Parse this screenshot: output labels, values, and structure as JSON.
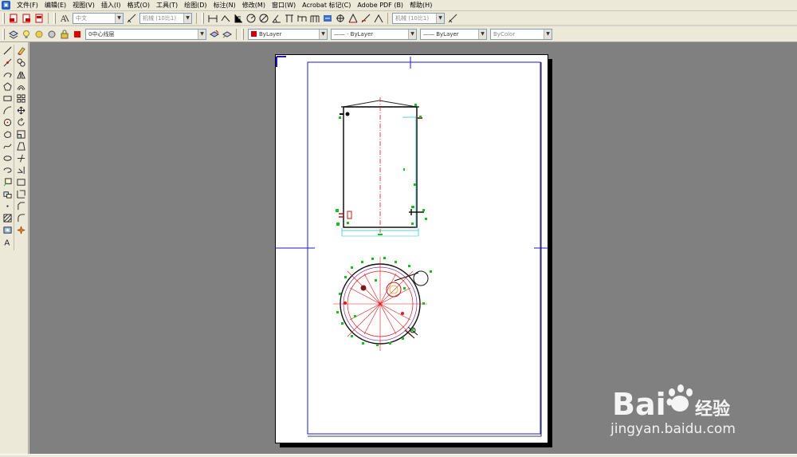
{
  "menu": {
    "items": [
      "文件(F)",
      "编辑(E)",
      "视图(V)",
      "插入(I)",
      "格式(O)",
      "工具(T)",
      "绘图(D)",
      "标注(N)",
      "修改(M)",
      "窗口(W)",
      "Acrobat 标记(C)",
      "Adobe PDF (B)",
      "帮助(H)"
    ]
  },
  "toolbar1": {
    "text_style": "中文",
    "dim_style_1": "机械 (10比1)",
    "dim_style_2": "机械 (10比1)"
  },
  "toolbar2": {
    "layer": "0中心线层",
    "color": "ByLayer",
    "linetype": "—— · ByLayer",
    "lineweight": "—— ByLayer",
    "plotstyle": "ByColor",
    "color_swatch": "#cc0000"
  },
  "draw_tools": [
    "line-icon",
    "construction-line-icon",
    "polyline-icon",
    "polygon-icon",
    "rectangle-icon",
    "arc-icon",
    "circle-icon",
    "revision-cloud-icon",
    "spline-icon",
    "ellipse-icon",
    "ellipse-arc-icon",
    "insert-block-icon",
    "make-block-icon",
    "point-icon",
    "hatch-icon",
    "region-icon",
    "multiline-text-icon"
  ],
  "modify_tools": [
    "erase-icon",
    "copy-icon",
    "mirror-icon",
    "offset-icon",
    "array-icon",
    "move-icon",
    "rotate-icon",
    "scale-icon",
    "stretch-icon",
    "trim-icon",
    "extend-icon",
    "break-icon",
    "join-icon",
    "chamfer-icon",
    "fillet-icon",
    "explode-icon"
  ],
  "watermark": {
    "brand": "Bai du 经验",
    "url": "jingyan.baidu.com"
  },
  "colors": {
    "frame_blue": "#1a1acc",
    "centerline_red": "#e01818",
    "dim_green": "#18c018",
    "cyan": "#20c0c0",
    "canvas_gray": "#808080"
  }
}
